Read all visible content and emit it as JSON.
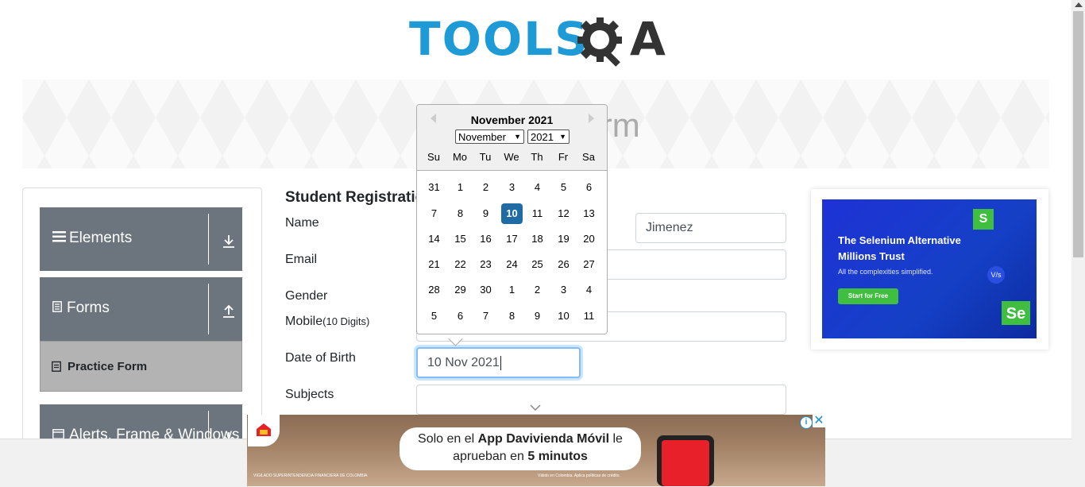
{
  "logo": {
    "text_left": "TOOLS",
    "text_right": "A"
  },
  "banner": {
    "title": "Practice Form"
  },
  "sidebar": {
    "groups": [
      {
        "label": "Elements",
        "icon": "hamburger-icon",
        "arrow": "download-arrow-icon"
      },
      {
        "label": "Forms",
        "icon": "document-icon",
        "arrow": "upload-arrow-icon"
      },
      {
        "label": "Alerts, Frame & Windows",
        "icon": "window-icon",
        "arrow": "download-arrow-icon"
      }
    ],
    "active_item": {
      "label": "Practice Form",
      "icon": "clipboard-icon"
    }
  },
  "form": {
    "title": "Student Registration Form",
    "name_label": "Name",
    "last_name_value": "Jimenez",
    "email_label": "Email",
    "gender_label": "Gender",
    "mobile_label": "Mobile",
    "mobile_hint": "(10 Digits)",
    "dob_label": "Date of Birth",
    "dob_value": "10 Nov 2021",
    "subjects_label": "Subjects"
  },
  "calendar": {
    "header": "November 2021",
    "month_select": "November",
    "year_select": "2021",
    "day_names": [
      "Su",
      "Mo",
      "Tu",
      "We",
      "Th",
      "Fr",
      "Sa"
    ],
    "weeks": [
      [
        "31",
        "1",
        "2",
        "3",
        "4",
        "5",
        "6"
      ],
      [
        "7",
        "8",
        "9",
        "10",
        "11",
        "12",
        "13"
      ],
      [
        "14",
        "15",
        "16",
        "17",
        "18",
        "19",
        "20"
      ],
      [
        "21",
        "22",
        "23",
        "24",
        "25",
        "26",
        "27"
      ],
      [
        "28",
        "29",
        "30",
        "1",
        "2",
        "3",
        "4"
      ],
      [
        "5",
        "6",
        "7",
        "8",
        "9",
        "10",
        "11"
      ]
    ],
    "selected_day": "10",
    "selected_color": "#216ba5"
  },
  "ad_right": {
    "headline": "The Selenium Alternative Millions Trust",
    "sub": "All the complexities simplified.",
    "cta": "Start for Free",
    "badge_s": "S",
    "badge_se": "Se",
    "badge_vs": "V/s"
  },
  "ad_bottom": {
    "line1_prefix": "Solo en el ",
    "line1_bold": "App Davivienda Móvil",
    "line1_suffix": " le",
    "line2_prefix": "aprueban en ",
    "line2_bold": "5 minutos",
    "fine_print": "Válido en Colombia. Aplica políticas de crédito.",
    "watermark": "VIGILADO SUPERINTENDENCIA FINANCIERA DE COLOMBIA",
    "info_icon": "i",
    "close_icon": "✕"
  }
}
